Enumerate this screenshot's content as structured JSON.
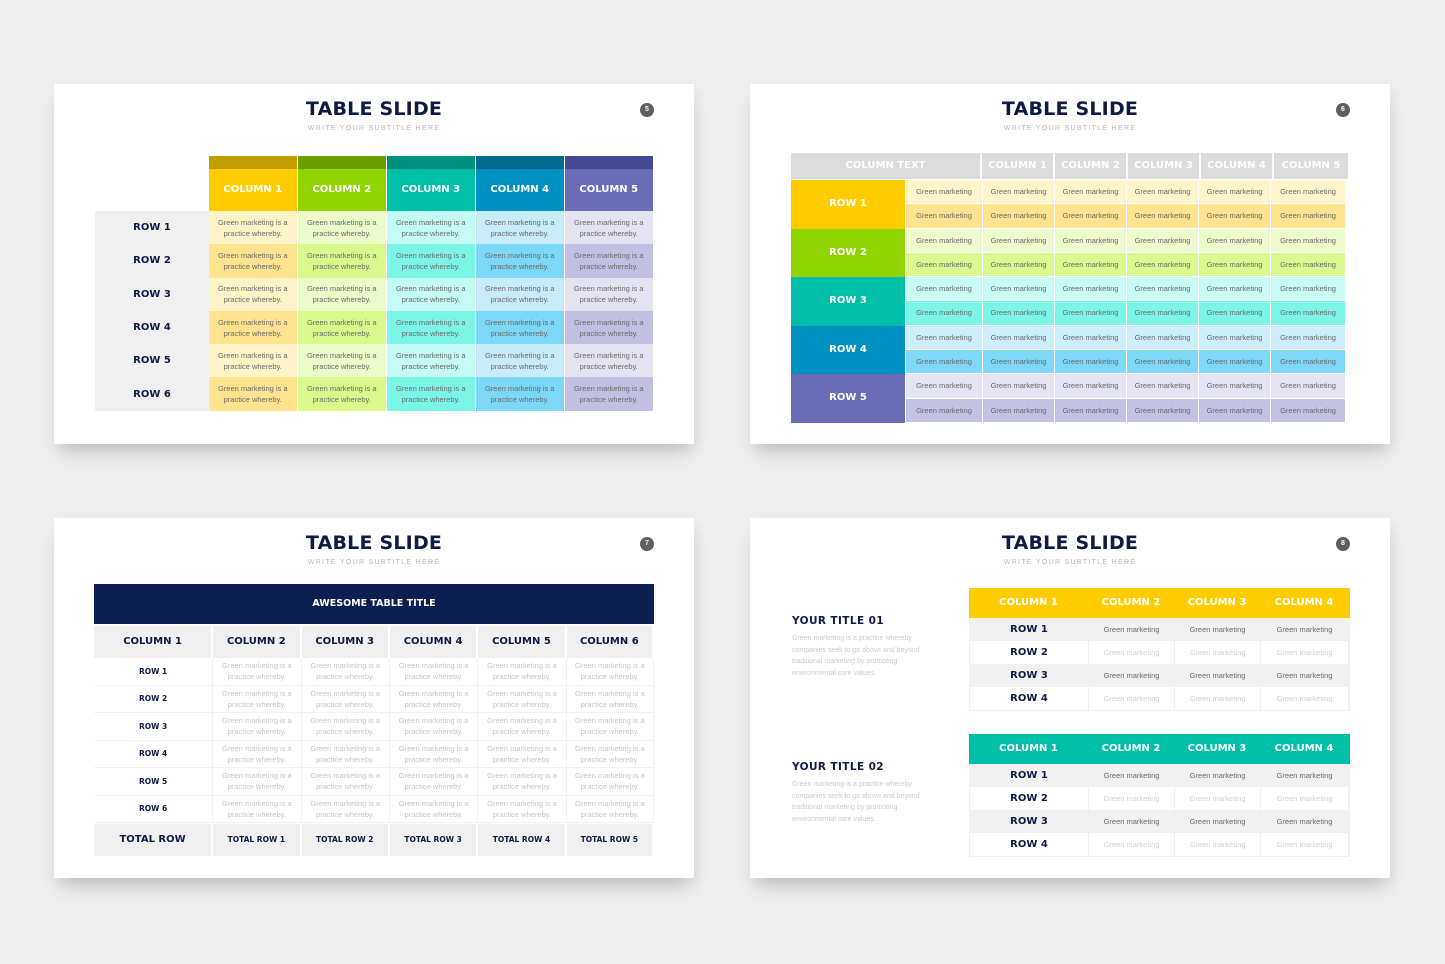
{
  "slides": [
    {
      "page": "5",
      "title": "TABLE SLIDE",
      "subtitle": "WRITE YOUR SUBTITLE HERE",
      "columns": [
        {
          "label": "COLUMN 1",
          "cap": "#c29d00",
          "header": "#ffcc00",
          "light": "#fff4c8",
          "dark": "#ffe38f"
        },
        {
          "label": "COLUMN 2",
          "cap": "#6c9e00",
          "header": "#92d400",
          "light": "#ecfbc9",
          "dark": "#d9f98c"
        },
        {
          "label": "COLUMN 3",
          "cap": "#00917e",
          "header": "#00bfa8",
          "light": "#c4fbf4",
          "dark": "#7bf5e6"
        },
        {
          "label": "COLUMN 4",
          "cap": "#006b8f",
          "header": "#0091c2",
          "light": "#c9ecfb",
          "dark": "#7dd7f7"
        },
        {
          "label": "COLUMN 5",
          "cap": "#434a93",
          "header": "#6a6db6",
          "light": "#e3e3f2",
          "dark": "#c1c0e2"
        }
      ],
      "rows": [
        "ROW 1",
        "ROW 2",
        "ROW 3",
        "ROW 4",
        "ROW 5",
        "ROW 6"
      ],
      "cell_text": "Green marketing is a practice whereby."
    },
    {
      "page": "6",
      "title": "TABLE SLIDE",
      "subtitle": "WRITE YOUR SUBTITLE HERE",
      "header": [
        "COLUMN TEXT",
        "COLUMN 1",
        "COLUMN 2",
        "COLUMN 3",
        "COLUMN 4",
        "COLUMN 5"
      ],
      "rows": [
        {
          "label": "ROW 1",
          "color": "#ffcc00",
          "light": "#fff6cb",
          "dark": "#ffe391"
        },
        {
          "label": "ROW 2",
          "color": "#92d400",
          "light": "#eefbcd",
          "dark": "#dbf98f"
        },
        {
          "label": "ROW 3",
          "color": "#00bfa8",
          "light": "#c9fbf5",
          "dark": "#7df5e6"
        },
        {
          "label": "ROW 4",
          "color": "#0091c2",
          "light": "#cdeefb",
          "dark": "#7fd8f7"
        },
        {
          "label": "ROW 5",
          "color": "#6a6db6",
          "light": "#e4e4f3",
          "dark": "#c3c2e3"
        }
      ],
      "cell_text": "Green marketing"
    },
    {
      "page": "7",
      "title": "TABLE SLIDE",
      "subtitle": "WRITE YOUR SUBTITLE HERE",
      "banner": "AWESOME TABLE TITLE",
      "header": [
        "COLUMN 1",
        "COLUMN 2",
        "COLUMN 3",
        "COLUMN 4",
        "COLUMN 5",
        "COLUMN 6"
      ],
      "rows": [
        "ROW 1",
        "ROW 2",
        "ROW 3",
        "ROW 4",
        "ROW 5",
        "ROW 6"
      ],
      "cell_text": "Green marketing is a practice whereby.",
      "totals": [
        "TOTAL ROW",
        "TOTAL ROW 1",
        "TOTAL ROW 2",
        "TOTAL ROW 3",
        "TOTAL ROW 4",
        "TOTAL ROW 5"
      ]
    },
    {
      "page": "8",
      "title": "TABLE SLIDE",
      "subtitle": "WRITE YOUR SUBTITLE HERE",
      "sections": [
        {
          "title": "YOUR TITLE 01",
          "text": "Green marketing is a practice whereby companies seek to go above and beyond traditional marketing by promoting environmental core values.",
          "color": "#ffcc00",
          "header": [
            "COLUMN 1",
            "COLUMN 2",
            "COLUMN 3",
            "COLUMN 4"
          ],
          "rows": [
            "ROW 1",
            "ROW 2",
            "ROW 3",
            "ROW 4"
          ],
          "cell_text": "Green marketing"
        },
        {
          "title": "YOUR TITLE 02",
          "text": "Green marketing is a practice whereby companies seek to go above and beyond traditional marketing by promoting environmental core values.",
          "color": "#00bfa8",
          "header": [
            "COLUMN 1",
            "COLUMN 2",
            "COLUMN 3",
            "COLUMN 4"
          ],
          "rows": [
            "ROW 1",
            "ROW 2",
            "ROW 3",
            "ROW 4"
          ],
          "cell_text": "Green marketing"
        }
      ]
    }
  ]
}
